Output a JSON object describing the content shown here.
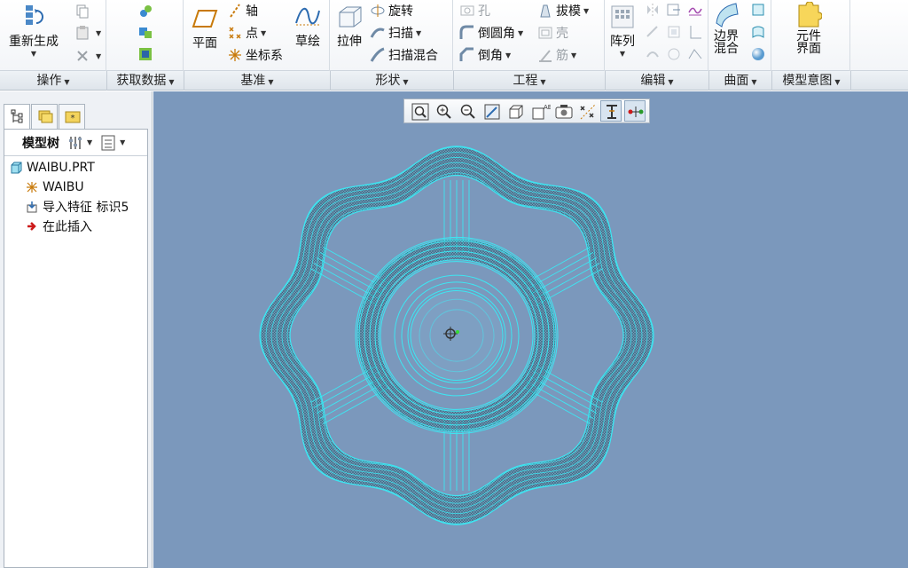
{
  "ribbon": {
    "operations": {
      "regenerate": "重新生成"
    },
    "datum": {
      "plane": "平面",
      "axis": "轴",
      "point": "点",
      "csys": "坐标系",
      "sketch": "草绘"
    },
    "shapes": {
      "extrude": "拉伸",
      "revolve": "旋转",
      "sweep": "扫描",
      "swept_blend": "扫描混合"
    },
    "engineering": {
      "hole": "孔",
      "round": "倒圆角",
      "chamfer": "倒角",
      "draft": "拔模",
      "shell": "壳",
      "rib": "筋"
    },
    "editing": {
      "pattern": "阵列"
    },
    "surfaces": {
      "boundary_blend_1": "边界",
      "boundary_blend_2": "混合"
    },
    "model_intent": {
      "component_interface_1": "元件",
      "component_interface_2": "界面"
    }
  },
  "groups": [
    "操作",
    "获取数据",
    "基准",
    "形状",
    "工程",
    "编辑",
    "曲面",
    "模型意图"
  ],
  "tree": {
    "header": "模型树",
    "items": [
      {
        "label": "WAIBU.PRT",
        "icon": "part-icon"
      },
      {
        "label": "WAIBU",
        "icon": "csys-icon"
      },
      {
        "label": "导入特征 标识5",
        "icon": "import-feature-icon"
      },
      {
        "label": "在此插入",
        "icon": "insert-here-arrow-icon"
      }
    ]
  },
  "colors": {
    "viewport_bg": "#7b98bc",
    "wireframe": "#3de6f2",
    "accent": "#2d6ea8"
  }
}
